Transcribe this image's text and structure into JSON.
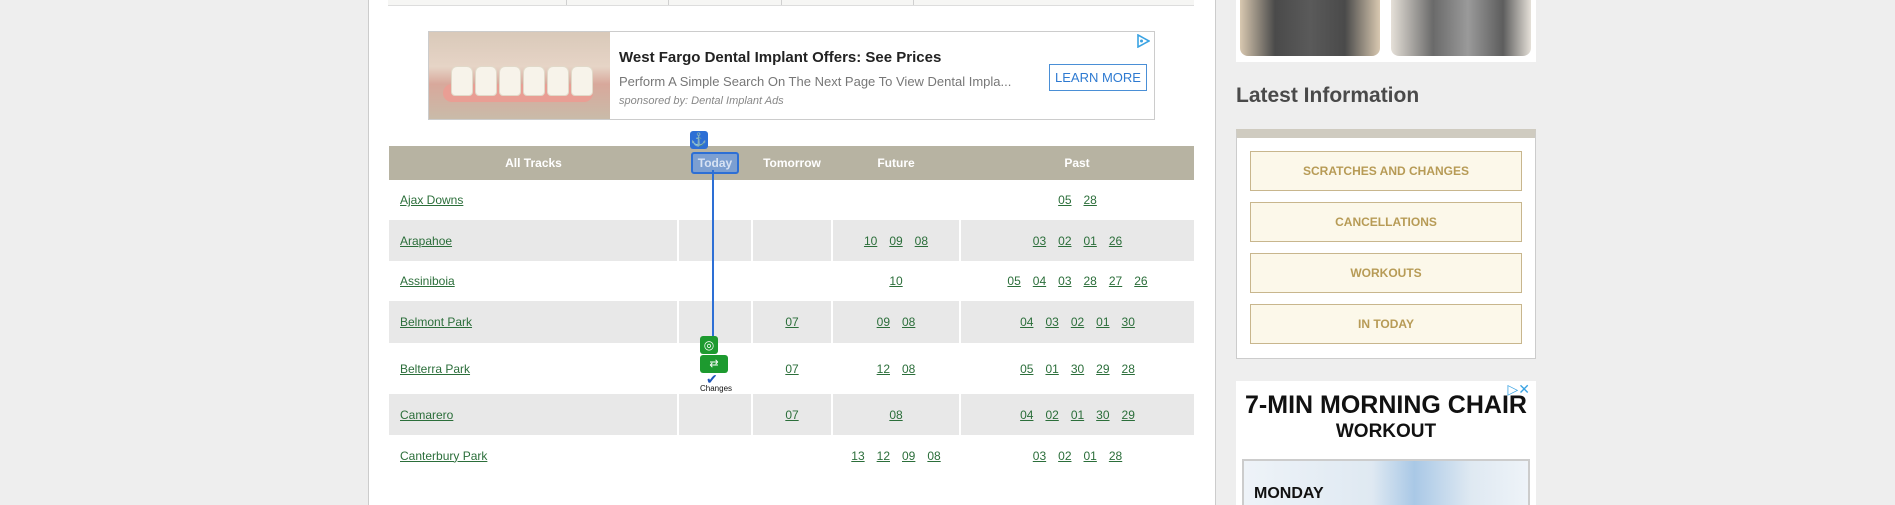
{
  "ad_banner": {
    "title": "West Fargo Dental Implant Offers: See Prices",
    "description": "Perform A Simple Search On The Next Page To View Dental Impla...",
    "sponsor": "sponsored by: Dental Implant Ads",
    "cta": "LEARN MORE",
    "adchoices_icon": "adchoices-triangle-icon"
  },
  "table": {
    "headers": [
      "All Tracks",
      "Today",
      "Tomorrow",
      "Future",
      "Past"
    ],
    "rows": [
      {
        "name": "Ajax Downs",
        "today": [],
        "tomorrow": [],
        "future": [],
        "past": [
          "05",
          "28"
        ]
      },
      {
        "name": "Arapahoe",
        "today": [],
        "tomorrow": [],
        "future": [
          "10",
          "09",
          "08"
        ],
        "past": [
          "03",
          "02",
          "01",
          "26"
        ]
      },
      {
        "name": "Assiniboia",
        "today": [],
        "tomorrow": [],
        "future": [
          "10"
        ],
        "past": [
          "05",
          "04",
          "03",
          "28",
          "27",
          "26"
        ]
      },
      {
        "name": "Belmont Park",
        "today": [],
        "tomorrow": [
          "07"
        ],
        "future": [
          "09",
          "08"
        ],
        "past": [
          "04",
          "03",
          "02",
          "01",
          "30"
        ]
      },
      {
        "name": "Belterra Park",
        "today": [],
        "tomorrow": [
          "07"
        ],
        "future": [
          "12",
          "08"
        ],
        "past": [
          "05",
          "01",
          "30",
          "29",
          "28"
        ]
      },
      {
        "name": "Camarero",
        "today": [],
        "tomorrow": [
          "07"
        ],
        "future": [
          "08"
        ],
        "past": [
          "04",
          "02",
          "01",
          "30",
          "29"
        ]
      },
      {
        "name": "Canterbury Park",
        "today": [],
        "tomorrow": [],
        "future": [
          "13",
          "12",
          "09",
          "08"
        ],
        "past": [
          "03",
          "02",
          "01",
          "28"
        ]
      }
    ]
  },
  "overlay": {
    "anchor_icon": "anchor-icon",
    "target_icon": "target-icon",
    "changes_icon": "changes-icon",
    "changes_label": "Changes"
  },
  "sidebar": {
    "heading": "Latest Information",
    "buttons": [
      "SCRATCHES AND CHANGES",
      "CANCELLATIONS",
      "WORKOUTS",
      "IN TODAY"
    ]
  },
  "ad2": {
    "title": "7-MIN MORNING CHAIR",
    "subtitle": "WORKOUT",
    "day": "MONDAY"
  },
  "colors": {
    "header_bg": "#b7b3a2",
    "link": "#2b6e3a",
    "button_text": "#b79b56",
    "highlight": "#2d6fd5",
    "overlay_green": "#1d9a2f"
  }
}
